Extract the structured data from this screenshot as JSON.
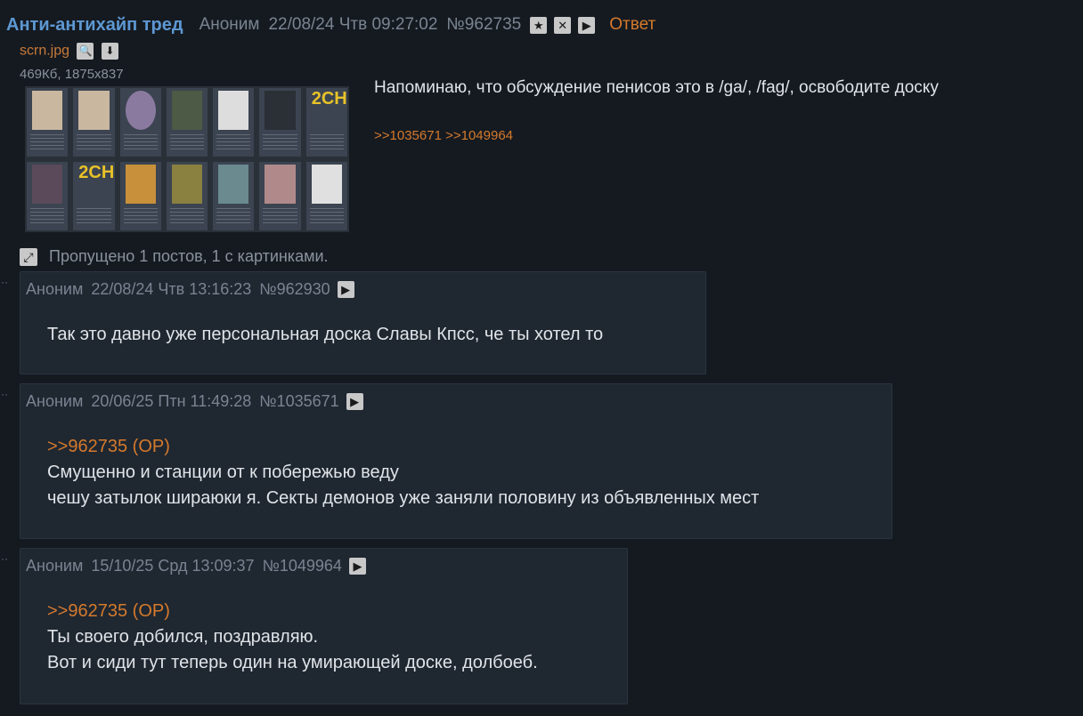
{
  "op": {
    "title": "Анти-антихайп тред",
    "author": "Аноним",
    "datetime": "22/08/24 Чтв 09:27:02",
    "number": "№962735",
    "reply_label": "Ответ",
    "file": {
      "name": "scrn.jpg",
      "meta": "469Кб, 1875x837"
    },
    "text": "Напоминаю, что обсуждение пенисов это в /ga/, /fag/, освободите доску",
    "refs": ">>1035671 >>1049964"
  },
  "omitted_text": "Пропущено 1 постов, 1 с картинками.",
  "replies": [
    {
      "author": "Аноним",
      "datetime": "22/08/24 Чтв 13:16:23",
      "number": "№962930",
      "lines": [
        "Так это давно уже персональная доска Славы Кпсс, че ты хотел то"
      ]
    },
    {
      "author": "Аноним",
      "datetime": "20/06/25 Птн 11:49:28",
      "number": "№1035671",
      "quote": ">>962735 (OP)",
      "lines": [
        "Смущенно и станции от к побережью веду",
        "чешу затылок шираюки я. Секты демонов уже заняли половину из объявленных мест"
      ]
    },
    {
      "author": "Аноним",
      "datetime": "15/10/25 Срд 13:09:37",
      "number": "№1049964",
      "quote": ">>962735 (OP)",
      "lines": [
        "Ты своего добился, поздравляю.",
        "Вот и сиди тут теперь один на умирающей доске, долбоеб."
      ]
    }
  ],
  "thumbnail_logo": "2CH"
}
